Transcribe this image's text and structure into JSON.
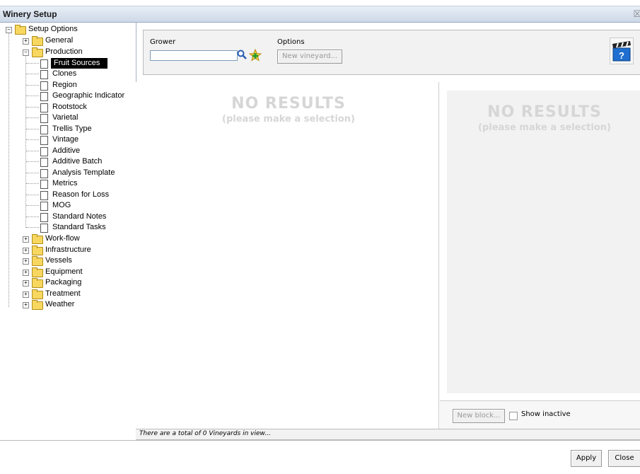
{
  "window": {
    "title": "Winery Setup"
  },
  "tree": {
    "root": "Setup Options",
    "folders": [
      "General",
      "Production",
      "Work-flow",
      "Infrastructure",
      "Vessels",
      "Equipment",
      "Packaging",
      "Treatment",
      "Weather"
    ],
    "production_items": [
      "Fruit Sources",
      "Clones",
      "Region",
      "Geographic Indicator",
      "Rootstock",
      "Varietal",
      "Trellis Type",
      "Vintage",
      "Additive",
      "Additive Batch",
      "Analysis Template",
      "Metrics",
      "Reason for Loss",
      "MOG",
      "Standard Notes",
      "Standard Tasks"
    ],
    "selected": "Fruit Sources"
  },
  "toolbar": {
    "grower_label": "Grower",
    "grower_value": "",
    "options_label": "Options",
    "new_vineyard_label": "New vineyard...",
    "search_icon": "search-icon",
    "add_favorite_icon": "add-favorite-icon",
    "help_icon": "help-clapperboard-icon"
  },
  "left_pane": {
    "no_results": "NO RESULTS",
    "hint": "(please make a selection)"
  },
  "right_pane": {
    "no_results": "NO RESULTS",
    "hint": "(please make a selection)",
    "new_block_label": "New block...",
    "show_inactive_label": "Show inactive",
    "show_inactive_checked": false
  },
  "status": {
    "text": "There are a total of 0 Vineyards in view..."
  },
  "footer": {
    "apply_label": "Apply",
    "close_label": "Close"
  },
  "colors": {
    "selected_bg": "#000000",
    "no_results": "#d6d6d6",
    "folder": "#f7d760"
  }
}
